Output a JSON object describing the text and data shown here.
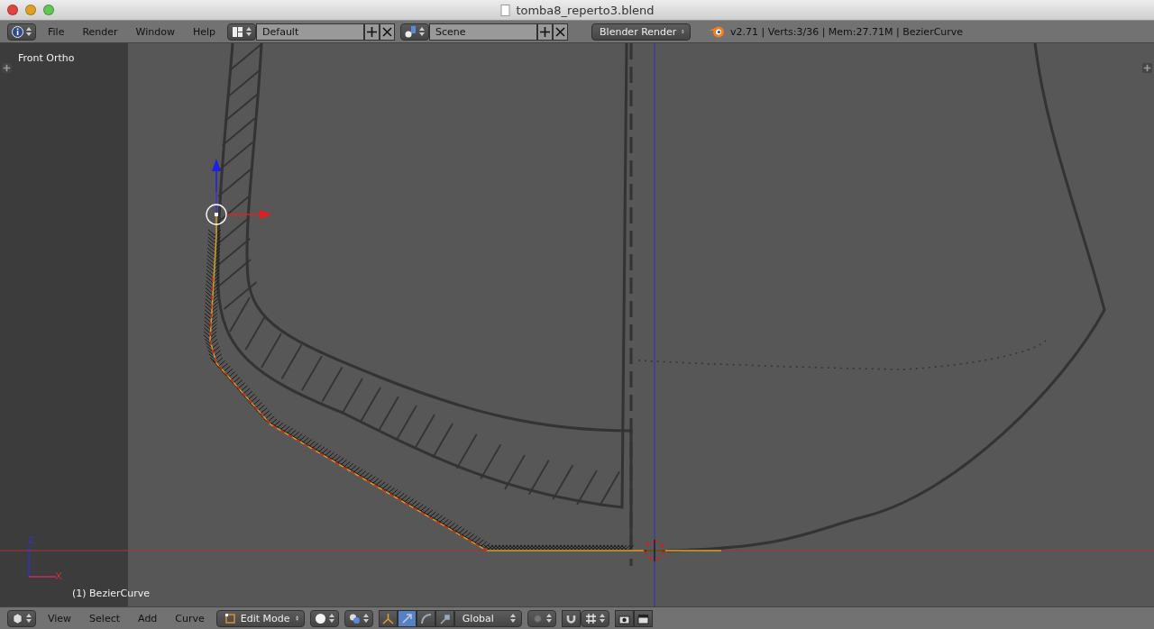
{
  "window": {
    "title": "tomba8_reperto3.blend"
  },
  "info_header": {
    "menus": [
      "File",
      "Render",
      "Window",
      "Help"
    ],
    "screen_layout": "Default",
    "scene": "Scene",
    "render_engine": "Blender Render",
    "stats": "v2.71 | Verts:3/36 | Mem:27.71M | BezierCurve"
  },
  "viewport": {
    "view_name": "Front Ortho",
    "object_label": "(1) BezierCurve"
  },
  "view_header": {
    "menus": [
      "View",
      "Select",
      "Add",
      "Curve"
    ],
    "mode": "Edit Mode",
    "transform_orientation": "Global",
    "manipulators": [
      {
        "kind": "translate",
        "selected": true
      },
      {
        "kind": "rotate",
        "selected": false
      },
      {
        "kind": "scale",
        "selected": false
      }
    ]
  }
}
